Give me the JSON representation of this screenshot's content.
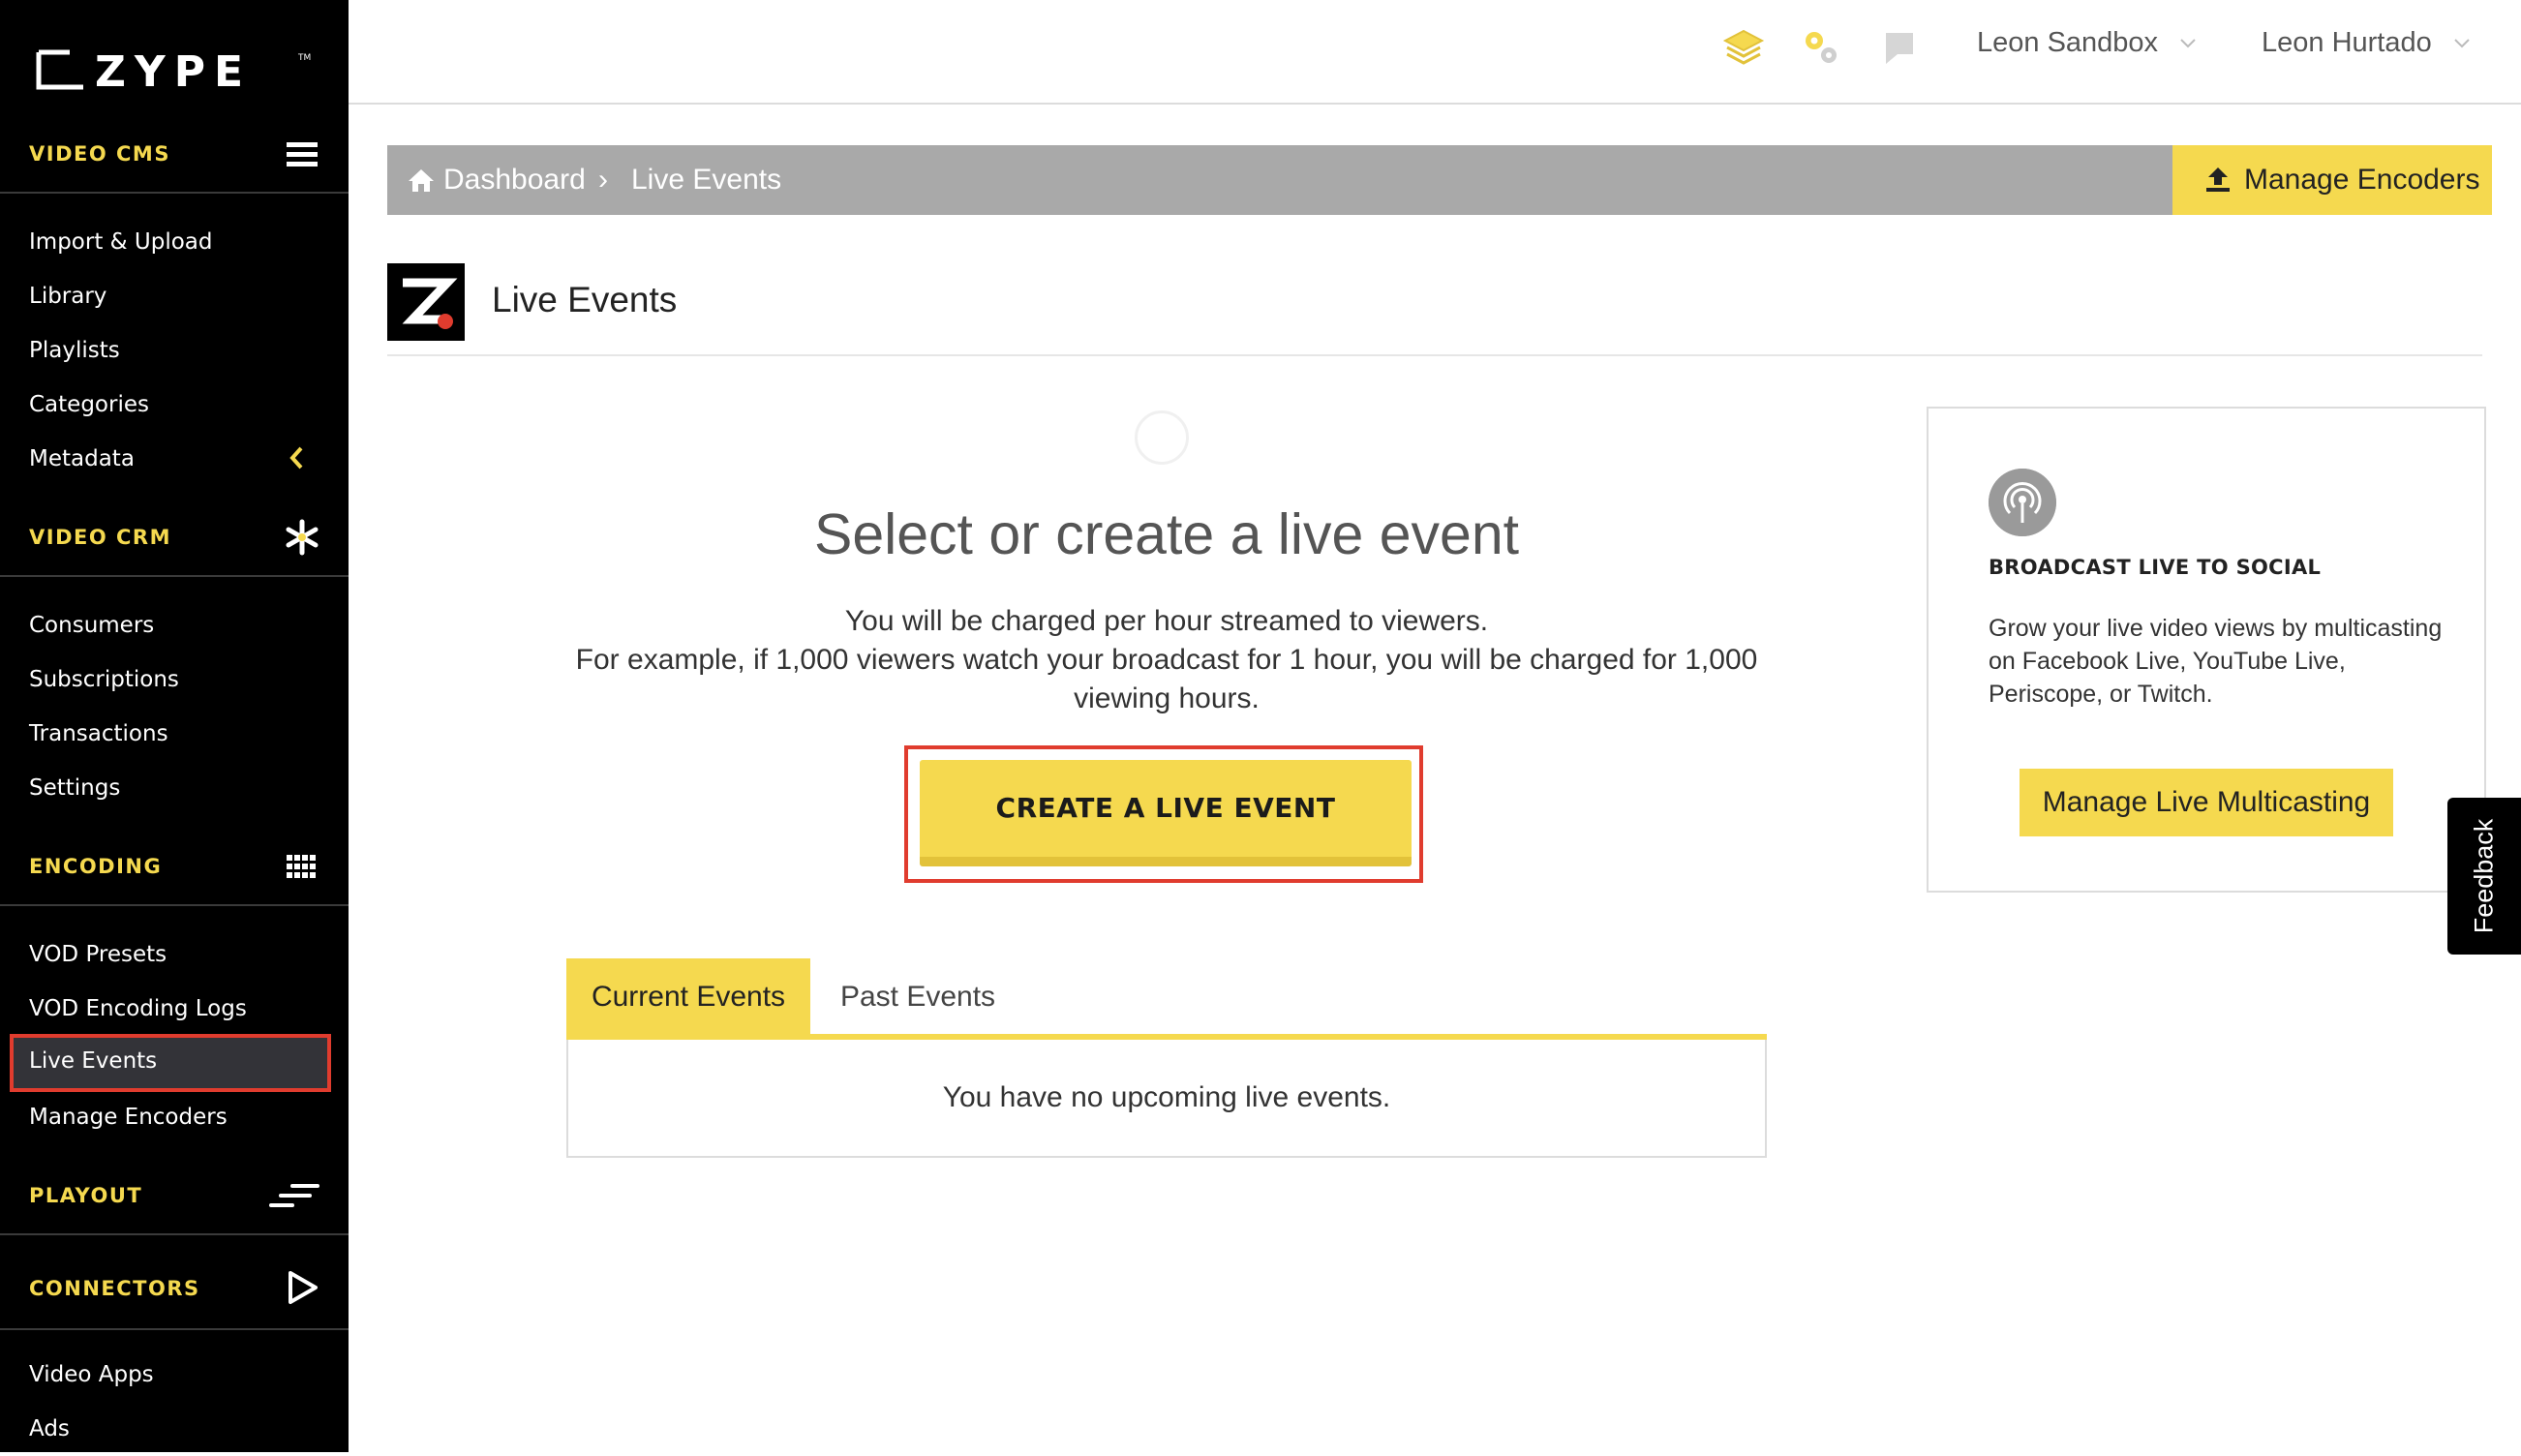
{
  "brand": {
    "logo_text": "ZYPE",
    "accent_color": "#f5d94f",
    "highlight_color": "#e03c2e"
  },
  "sidebar": {
    "sections": [
      {
        "label": "VIDEO CMS",
        "icon": "hamburger-menu-icon",
        "items": [
          "Import & Upload",
          "Library",
          "Playlists",
          "Categories",
          "Metadata"
        ]
      },
      {
        "label": "VIDEO CRM",
        "icon": "asterisk-icon",
        "items": [
          "Consumers",
          "Subscriptions",
          "Transactions",
          "Settings"
        ]
      },
      {
        "label": "ENCODING",
        "icon": "grid-icon",
        "items": [
          "VOD Presets",
          "VOD Encoding Logs",
          "Live Events",
          "Manage Encoders"
        ]
      },
      {
        "label": "PLAYOUT",
        "icon": "playout-lines-icon",
        "items": []
      },
      {
        "label": "CONNECTORS",
        "icon": "play-triangle-icon",
        "items": [
          "Video Apps",
          "Ads"
        ]
      }
    ],
    "active_item": "Live Events"
  },
  "topbar": {
    "icons": [
      "layers-icon",
      "gears-icon",
      "flag-icon"
    ],
    "account": "Leon Sandbox",
    "user": "Leon Hurtado"
  },
  "breadcrumb": {
    "home_icon": "home-icon",
    "items": [
      "Dashboard",
      "Live Events"
    ],
    "manage_encoders_label": "Manage Encoders"
  },
  "page": {
    "title": "Live Events",
    "headline": "Select or create a live event",
    "description_line1": "You will be charged per hour streamed to viewers.",
    "description_line2": "For example, if 1,000 viewers watch your broadcast for 1 hour, you will be charged for 1,000 viewing hours.",
    "cta_label": "CREATE A LIVE EVENT"
  },
  "tabs": {
    "items": [
      "Current Events",
      "Past Events"
    ],
    "active": "Current Events",
    "empty_message": "You have no upcoming live events."
  },
  "social_card": {
    "icon": "broadcast-icon",
    "title": "BROADCAST LIVE TO SOCIAL",
    "text": "Grow your live video views by multicasting on Facebook Live, YouTube Live, Periscope, or Twitch.",
    "button_label": "Manage Live Multicasting"
  },
  "feedback_label": "Feedback"
}
